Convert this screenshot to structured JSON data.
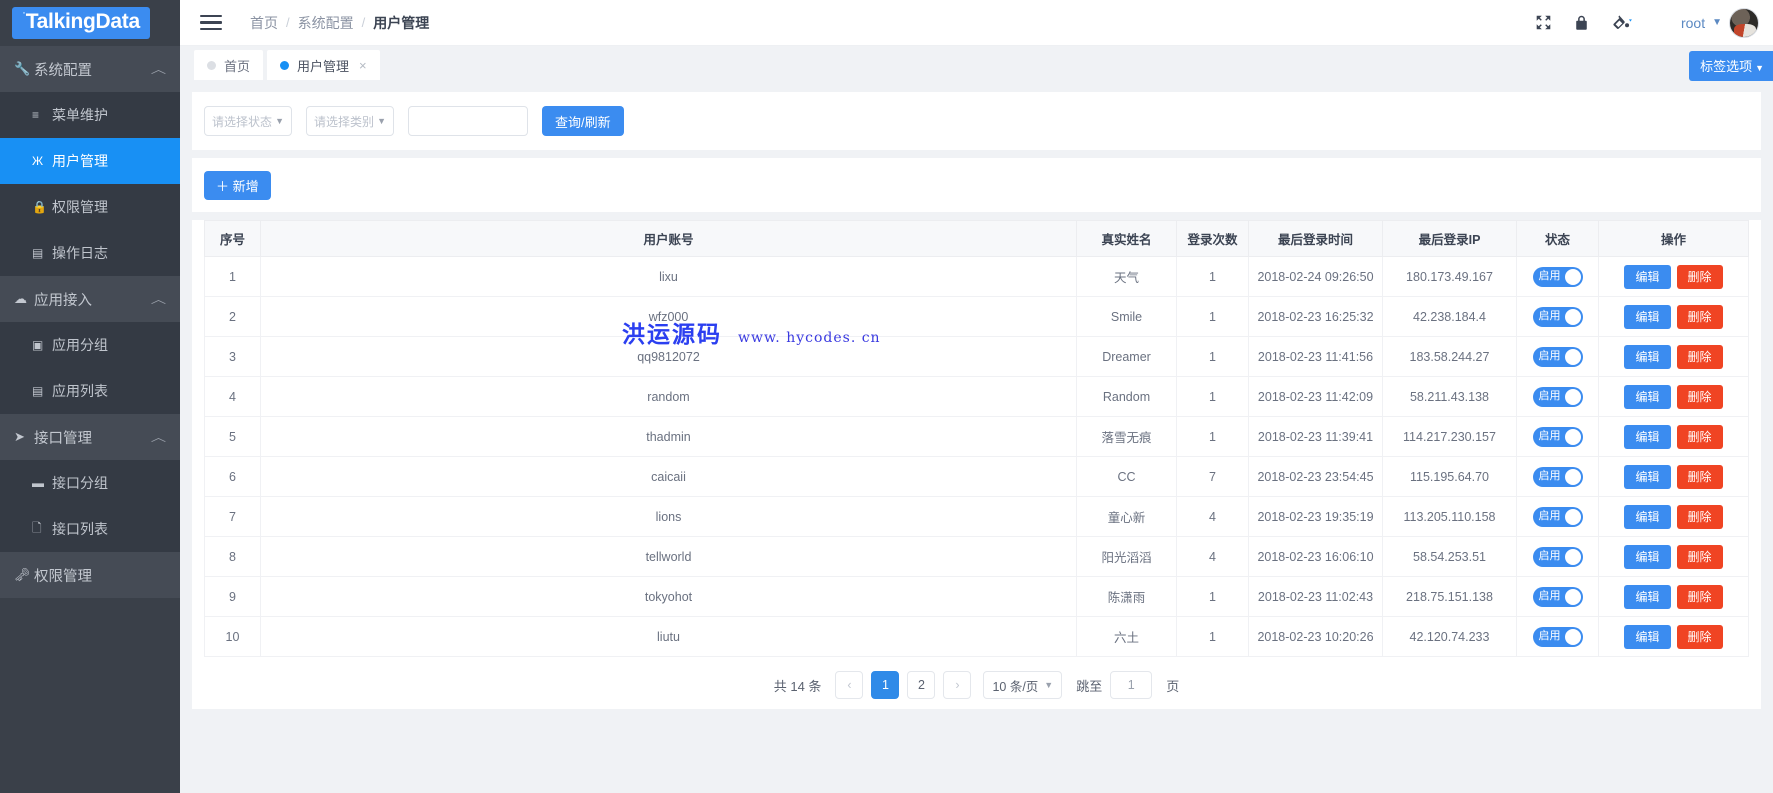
{
  "brand": {
    "name": "TalkingData"
  },
  "sidebar": {
    "groups": [
      {
        "label": "系统配置",
        "icon": "wrench-icon",
        "chevron": "︿",
        "items": [
          {
            "label": "菜单维护",
            "icon": "menu-lines-icon",
            "glyph": "≡",
            "active": false
          },
          {
            "label": "用户管理",
            "icon": "users-icon",
            "glyph": "Ж",
            "active": true
          },
          {
            "label": "权限管理",
            "icon": "lock-icon",
            "glyph": "🔒",
            "active": false
          },
          {
            "label": "操作日志",
            "icon": "log-book-icon",
            "glyph": "☷",
            "active": false
          }
        ]
      },
      {
        "label": "应用接入",
        "icon": "cloud-icon",
        "chevron": "︿",
        "items": [
          {
            "label": "应用分组",
            "icon": "folder-group-icon",
            "glyph": "▣",
            "active": false
          },
          {
            "label": "应用列表",
            "icon": "list-icon",
            "glyph": "▤",
            "active": false
          }
        ]
      },
      {
        "label": "接口管理",
        "icon": "send-icon",
        "chevron": "︿",
        "items": [
          {
            "label": "接口分组",
            "icon": "folder-icon",
            "glyph": "▬",
            "active": false
          },
          {
            "label": "接口列表",
            "icon": "file-icon",
            "glyph": "✐",
            "active": false
          }
        ]
      }
    ],
    "bottom": {
      "label": "权限管理",
      "icon": "key-icon"
    }
  },
  "topbar": {
    "hamburger_icon": "hamburger-icon",
    "breadcrumb": [
      "首页",
      "系统配置",
      "用户管理"
    ],
    "separator": "/",
    "icons": [
      "fullscreen-icon",
      "lock-icon",
      "theme-paint-icon"
    ],
    "user_name": "root",
    "user_caret": "▼"
  },
  "tabs": {
    "items": [
      {
        "label": "首页",
        "active": false,
        "closable": false
      },
      {
        "label": "用户管理",
        "active": true,
        "closable": true,
        "close": "×"
      }
    ],
    "tag_options": {
      "label": "标签选项",
      "caret": "▼"
    }
  },
  "filters": {
    "status_placeholder": "请选择状态",
    "type_placeholder": "请选择类别",
    "keyword_value": "",
    "keyword_placeholder": "",
    "search_button": "查询/刷新",
    "caret": "▼"
  },
  "toolbar": {
    "add_button": "＋ 新增"
  },
  "table": {
    "columns": [
      "序号",
      "用户账号",
      "真实姓名",
      "登录次数",
      "最后登录时间",
      "最后登录IP",
      "状态",
      "操作"
    ],
    "rows": [
      {
        "idx": "1",
        "account": "lixu",
        "name": "天气",
        "count": "1",
        "time": "2018-02-24 09:26:50",
        "ip": "180.173.49.167",
        "status": "启用",
        "edit": "编辑",
        "del": "删除"
      },
      {
        "idx": "2",
        "account": "wfz000",
        "name": "Smile",
        "count": "1",
        "time": "2018-02-23 16:25:32",
        "ip": "42.238.184.4",
        "status": "启用",
        "edit": "编辑",
        "del": "删除"
      },
      {
        "idx": "3",
        "account": "qq9812072",
        "name": "Dreamer",
        "count": "1",
        "time": "2018-02-23 11:41:56",
        "ip": "183.58.244.27",
        "status": "启用",
        "edit": "编辑",
        "del": "删除"
      },
      {
        "idx": "4",
        "account": "random",
        "name": "Random",
        "count": "1",
        "time": "2018-02-23 11:42:09",
        "ip": "58.211.43.138",
        "status": "启用",
        "edit": "编辑",
        "del": "删除"
      },
      {
        "idx": "5",
        "account": "thadmin",
        "name": "落雪无痕",
        "count": "1",
        "time": "2018-02-23 11:39:41",
        "ip": "114.217.230.157",
        "status": "启用",
        "edit": "编辑",
        "del": "删除"
      },
      {
        "idx": "6",
        "account": "caicaii",
        "name": "CC",
        "count": "7",
        "time": "2018-02-23 23:54:45",
        "ip": "115.195.64.70",
        "status": "启用",
        "edit": "编辑",
        "del": "删除"
      },
      {
        "idx": "7",
        "account": "lions",
        "name": "童心新",
        "count": "4",
        "time": "2018-02-23 19:35:19",
        "ip": "113.205.110.158",
        "status": "启用",
        "edit": "编辑",
        "del": "删除"
      },
      {
        "idx": "8",
        "account": "tellworld",
        "name": "阳光滔滔",
        "count": "4",
        "time": "2018-02-23 16:06:10",
        "ip": "58.54.253.51",
        "status": "启用",
        "edit": "编辑",
        "del": "删除"
      },
      {
        "idx": "9",
        "account": "tokyohot",
        "name": "陈潇雨",
        "count": "1",
        "time": "2018-02-23 11:02:43",
        "ip": "218.75.151.138",
        "status": "启用",
        "edit": "编辑",
        "del": "删除"
      },
      {
        "idx": "10",
        "account": "liutu",
        "name": "六土",
        "count": "1",
        "time": "2018-02-23 10:20:26",
        "ip": "42.120.74.233",
        "status": "启用",
        "edit": "编辑",
        "del": "删除"
      }
    ]
  },
  "pagination": {
    "total_label": "共 14 条",
    "prev": "‹",
    "pages": [
      "1",
      "2"
    ],
    "current_page": "1",
    "next": "›",
    "page_size": "10 条/页",
    "caret": "▼",
    "jump_label": "跳至",
    "jump_value": "1",
    "jump_suffix": "页"
  },
  "watermark": {
    "text_cn": "洪运源码",
    "text_url": "www. hycodes. cn"
  },
  "colors": {
    "primary": "#3b8cf0",
    "danger": "#f04423",
    "sidebar": "#3a4049",
    "active": "#1890f4"
  }
}
